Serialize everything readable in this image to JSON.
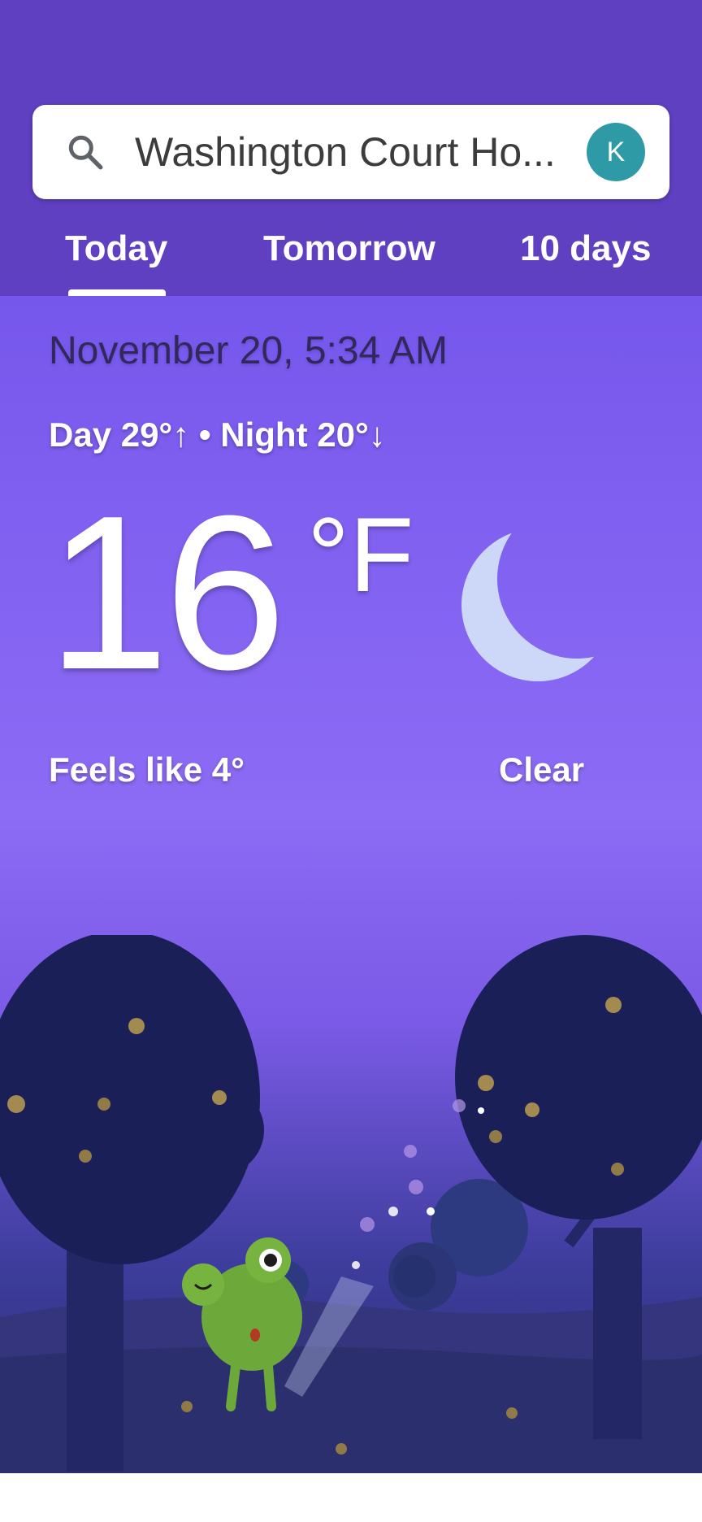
{
  "search": {
    "location": "Washington Court Ho...",
    "avatar_initial": "K"
  },
  "tabs": [
    {
      "label": "Today",
      "selected": true
    },
    {
      "label": "Tomorrow",
      "selected": false
    },
    {
      "label": "10 days",
      "selected": false
    }
  ],
  "weather": {
    "datetime": "November 20, 5:34 AM",
    "day_night": "Day 29°↑ • Night 20°↓",
    "temperature": "16",
    "unit": "°F",
    "feels_like": "Feels like 4°",
    "condition": "Clear",
    "condition_icon": "moon-icon"
  },
  "colors": {
    "header": "#5e40c1",
    "sky_top": "#7657ec",
    "avatar": "#2e9aa5",
    "moon": "#cdd8f8"
  }
}
